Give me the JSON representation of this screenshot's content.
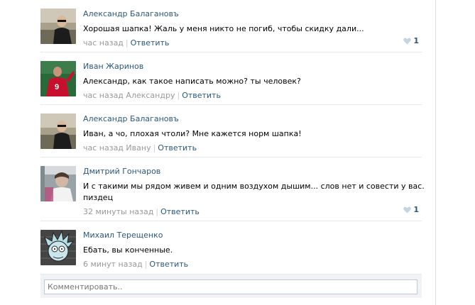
{
  "comments": [
    {
      "author": "Александр Балагановъ",
      "text": "Хорошая шапка! Жаль у меня никто не погиб, чтобы скидку дали...",
      "time": "час назад",
      "reply_to": "",
      "reply_label": "Ответить",
      "likes": "1"
    },
    {
      "author": "Иван Жаринов",
      "text": "Александр, как такое написать можно? ты человек?",
      "time": "час назад",
      "reply_to": "Александру",
      "reply_label": "Ответить",
      "likes": ""
    },
    {
      "author": "Александр Балагановъ",
      "text": "Иван, а чо, плохая чтоли? Мне кажется норм шапка!",
      "time": "час назад",
      "reply_to": "Ивану",
      "reply_label": "Ответить",
      "likes": ""
    },
    {
      "author": "Дмитрий Гончаров",
      "text": "И с такими мы рядом живем и одним воздухом дышим... слов нет и совести у вас.",
      "text2": "пиздец",
      "time": "32 минуты назад",
      "reply_to": "",
      "reply_label": "Ответить",
      "likes": "1"
    },
    {
      "author": "Михаил Терещенко",
      "text": "Ебать, вы конченные.",
      "time": "6 минут назад",
      "reply_to": "",
      "reply_label": "Ответить",
      "likes": ""
    }
  ],
  "reply_box": {
    "placeholder": "Комментировать.."
  },
  "colors": {
    "link": "#2b587a",
    "meta": "#999999",
    "like_heart": "#c5d3e2",
    "reply_box_bg": "#f0f2f5"
  }
}
